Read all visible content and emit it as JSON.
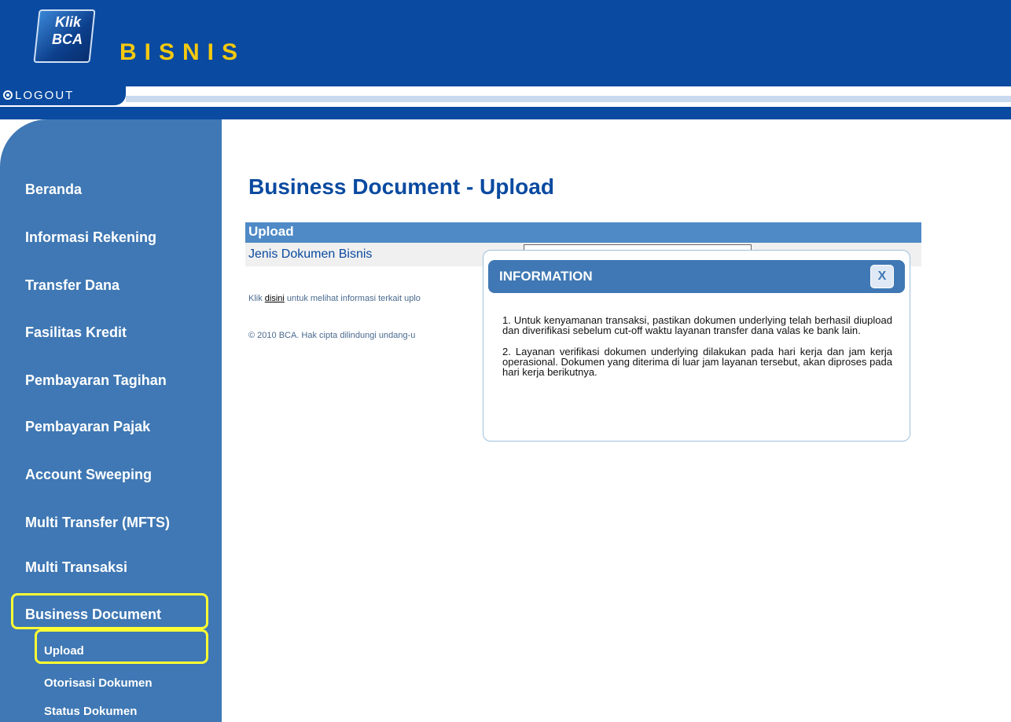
{
  "header": {
    "logo_line1": "Klik",
    "logo_line2": "BCA",
    "brand": "BISNIS",
    "logout_label": "LOGOUT"
  },
  "sidebar": {
    "items": [
      {
        "label": "Beranda"
      },
      {
        "label": "Informasi Rekening"
      },
      {
        "label": "Transfer Dana"
      },
      {
        "label": "Fasilitas Kredit"
      },
      {
        "label": "Pembayaran Tagihan"
      },
      {
        "label": "Pembayaran Pajak"
      },
      {
        "label": "Account Sweeping"
      },
      {
        "label": "Multi Transfer (MFTS)"
      },
      {
        "label": "Multi Transaksi"
      },
      {
        "label": "Business Document"
      }
    ],
    "subitems": [
      {
        "label": "Upload"
      },
      {
        "label": "Otorisasi Dokumen"
      },
      {
        "label": "Status Dokumen"
      }
    ]
  },
  "main": {
    "title": "Business Document - Upload",
    "panel_header": "Upload",
    "field_label": "Jenis Dokumen Bisnis",
    "info_prefix": "Klik ",
    "info_link": "disini",
    "info_suffix": " untuk melihat informasi terkait uplo",
    "copyright": "© 2010 BCA. Hak cipta dilindungi undang-u"
  },
  "modal": {
    "title": "INFORMATION",
    "close_label": "X",
    "paragraph1": "1. Untuk kenyamanan transaksi, pastikan dokumen underlying telah berhasil diupload dan diverifikasi sebelum cut-off waktu layanan transfer dana valas ke bank lain.",
    "paragraph2": "2. Layanan verifikasi dokumen underlying dilakukan pada hari kerja dan jam kerja operasional. Dokumen yang diterima di luar jam layanan tersebut, akan diproses pada hari kerja berikutnya."
  },
  "colors": {
    "header_blue": "#0a4aa0",
    "sidebar_blue": "#3f78b4",
    "brand_yellow": "#f5c90f",
    "highlight_yellow": "#ffff33"
  }
}
